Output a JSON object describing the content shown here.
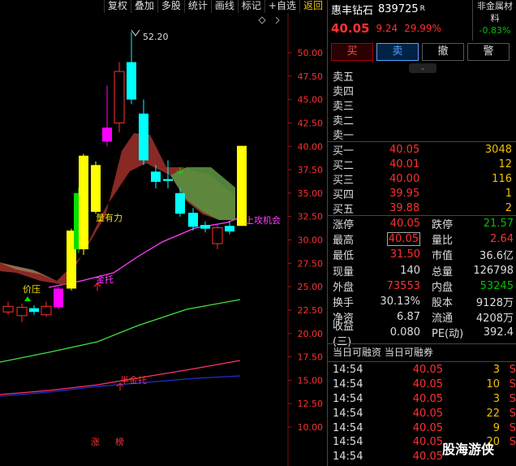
{
  "toolbar": {
    "items": [
      "复权",
      "叠加",
      "多股",
      "统计",
      "画线",
      "标记",
      "+自选",
      "返回"
    ]
  },
  "chart": {
    "peak_label": "52.20",
    "y_ticks": [
      "50.00",
      "47.50",
      "45.00",
      "42.50",
      "40.00",
      "37.50",
      "35.00",
      "32.50",
      "30.00",
      "27.50",
      "25.00",
      "22.50",
      "20.00",
      "17.50",
      "15.00",
      "12.50",
      "10.00"
    ],
    "annotations": {
      "jiaya": "价压",
      "jintuo": "金托",
      "liangyouli": "量有力",
      "shanggong": "上攻机会",
      "banjintuo": "半金托"
    },
    "bottom_tags": [
      "涨",
      "榜"
    ],
    "colors": {
      "up": "#ff3030",
      "down": "#00ffff",
      "yellow": "#ffff00",
      "green": "#00e000",
      "magenta": "#ff00ff"
    }
  },
  "quote": {
    "name": "惠丰钻石",
    "code": "839725",
    "badge": "R",
    "price": "40.05",
    "change": "9.24",
    "pct": "29.99%",
    "sector_line1": "非金属材",
    "sector_line2": "料",
    "sector_change": "-0.83%"
  },
  "buttons": {
    "buy": "买",
    "sell": "卖",
    "cancel": "撤",
    "alert": "警"
  },
  "expand_icon": "chevron-down-icon",
  "sell_book": [
    {
      "label": "卖五",
      "price": "",
      "vol": ""
    },
    {
      "label": "卖四",
      "price": "",
      "vol": ""
    },
    {
      "label": "卖三",
      "price": "",
      "vol": ""
    },
    {
      "label": "卖二",
      "price": "",
      "vol": ""
    },
    {
      "label": "卖一",
      "price": "",
      "vol": ""
    }
  ],
  "buy_book": [
    {
      "label": "买一",
      "price": "40.05",
      "vol": "3048"
    },
    {
      "label": "买二",
      "price": "40.01",
      "vol": "12"
    },
    {
      "label": "买三",
      "price": "40.00",
      "vol": "116"
    },
    {
      "label": "买四",
      "price": "39.95",
      "vol": "1"
    },
    {
      "label": "买五",
      "price": "39.88",
      "vol": "2"
    }
  ],
  "stats": [
    {
      "k1": "涨停",
      "v1": "40.05",
      "k2": "跌停",
      "v2": "21.57"
    },
    {
      "k1": "最高",
      "v1": "40.05",
      "k2": "量比",
      "v2": "2.64"
    },
    {
      "k1": "最低",
      "v1": "31.50",
      "k2": "市值",
      "v2": "36.6亿"
    },
    {
      "k1": "现量",
      "v1": "140",
      "k2": "总量",
      "v2": "126798"
    },
    {
      "k1": "外盘",
      "v1": "73553",
      "k2": "内盘",
      "v2": "53245"
    },
    {
      "k1": "换手",
      "v1": "30.13%",
      "k2": "股本",
      "v2": "9128万"
    },
    {
      "k1": "净资",
      "v1": "6.87",
      "k2": "流通",
      "v2": "4208万"
    },
    {
      "k1": "收益(三)",
      "v1": "0.080",
      "k2": "PE(动)",
      "v2": "392.4"
    }
  ],
  "margin_header": "当日可融资 当日可融券",
  "trades": [
    {
      "time": "14:54",
      "price": "40.05",
      "vol": "3",
      "side": "S"
    },
    {
      "time": "14:54",
      "price": "40.05",
      "vol": "10",
      "side": "S"
    },
    {
      "time": "14:54",
      "price": "40.05",
      "vol": "3",
      "side": "S"
    },
    {
      "time": "14:54",
      "price": "40.05",
      "vol": "22",
      "side": "S"
    },
    {
      "time": "14:54",
      "price": "40.05",
      "vol": "9",
      "side": "S"
    },
    {
      "time": "14:54",
      "price": "40.05",
      "vol": "20",
      "side": "S"
    },
    {
      "time": "14:54",
      "price": "40.05",
      "vol": "",
      "side": ""
    }
  ],
  "watermark": "股海游侠"
}
